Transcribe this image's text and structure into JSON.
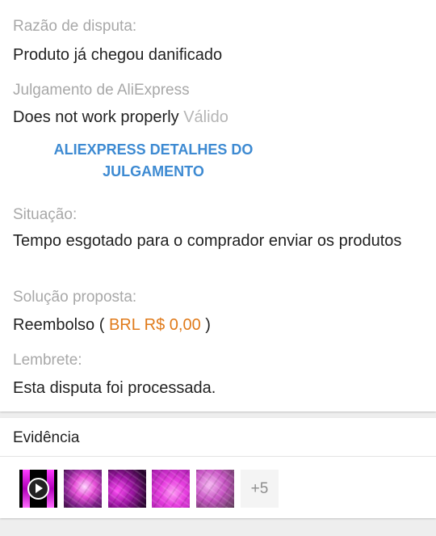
{
  "dispute": {
    "reason_label": "Razão de disputa:",
    "reason_value": "Produto já chegou danificado",
    "judgment_label": "Julgamento de AliExpress",
    "judgment_value": "Does not work properly",
    "judgment_status": "Válido",
    "details_button": "ALIEXPRESS DETALHES DO JULGAMENTO",
    "situation_label": "Situação:",
    "situation_value": "Tempo esgotado para o comprador enviar os produtos",
    "solution_label": "Solução proposta:",
    "solution_prefix": "Reembolso (",
    "solution_amount": "BRL R$ 0,00",
    "solution_suffix": ")",
    "reminder_label": "Lembrete:",
    "reminder_value": "Esta disputa foi processada."
  },
  "evidence": {
    "title": "Evidência",
    "more_count": "+5"
  },
  "colors": {
    "link": "#3d8ad2",
    "amount": "#e07a1a",
    "label": "#a8a8a8"
  }
}
